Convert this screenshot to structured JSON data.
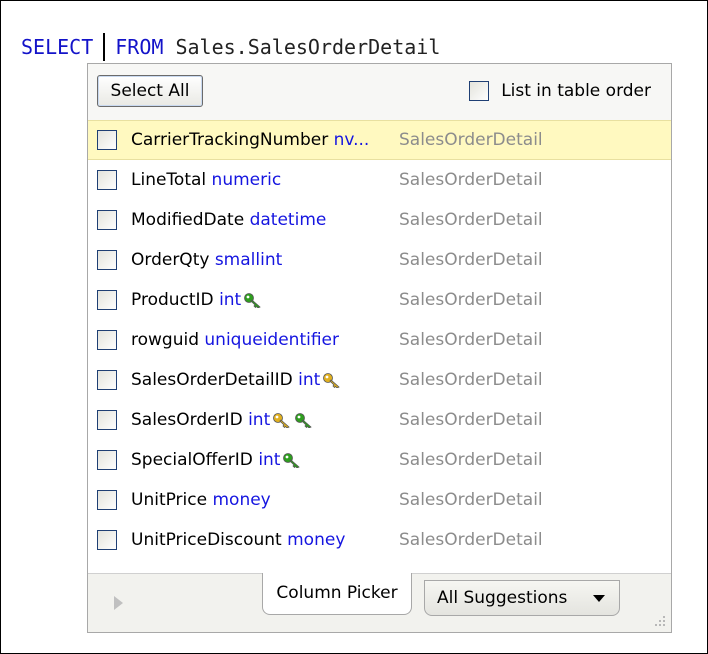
{
  "editor": {
    "keyword_select": "SELECT",
    "keyword_from": "FROM",
    "table_ref": " Sales.SalesOrderDetail"
  },
  "popup": {
    "select_all_label": "Select All",
    "list_order_label": "List in table order",
    "list_order_checked": false,
    "columns": [
      {
        "name": "CarrierTrackingNumber",
        "type": "nv...",
        "table": "SalesOrderDetail",
        "keys": [],
        "selected": true
      },
      {
        "name": "LineTotal",
        "type": "numeric",
        "table": "SalesOrderDetail",
        "keys": []
      },
      {
        "name": "ModifiedDate",
        "type": "datetime",
        "table": "SalesOrderDetail",
        "keys": []
      },
      {
        "name": "OrderQty",
        "type": "smallint",
        "table": "SalesOrderDetail",
        "keys": []
      },
      {
        "name": "ProductID",
        "type": "int",
        "table": "SalesOrderDetail",
        "keys": [
          "foreign"
        ]
      },
      {
        "name": "rowguid",
        "type": "uniqueidentifier",
        "table": "SalesOrderDetail",
        "keys": []
      },
      {
        "name": "SalesOrderDetailID",
        "type": "int",
        "table": "SalesOrderDetail",
        "keys": [
          "primary"
        ]
      },
      {
        "name": "SalesOrderID",
        "type": "int",
        "table": "SalesOrderDetail",
        "keys": [
          "primary",
          "foreign"
        ]
      },
      {
        "name": "SpecialOfferID",
        "type": "int",
        "table": "SalesOrderDetail",
        "keys": [
          "foreign"
        ]
      },
      {
        "name": "UnitPrice",
        "type": "money",
        "table": "SalesOrderDetail",
        "keys": []
      },
      {
        "name": "UnitPriceDiscount",
        "type": "money",
        "table": "SalesOrderDetail",
        "keys": []
      }
    ],
    "tabs": {
      "column_picker": "Column Picker",
      "all_suggestions": "All Suggestions"
    }
  },
  "colors": {
    "keyword": "#1313c9",
    "type": "#1515e0",
    "table": "#8c8c8c",
    "selected_row": "#fff9c0",
    "primary_key": "#e0b020",
    "foreign_key": "#2e9e1e"
  },
  "icons": {
    "primary": "gold-key-icon",
    "foreign": "green-key-icon"
  }
}
